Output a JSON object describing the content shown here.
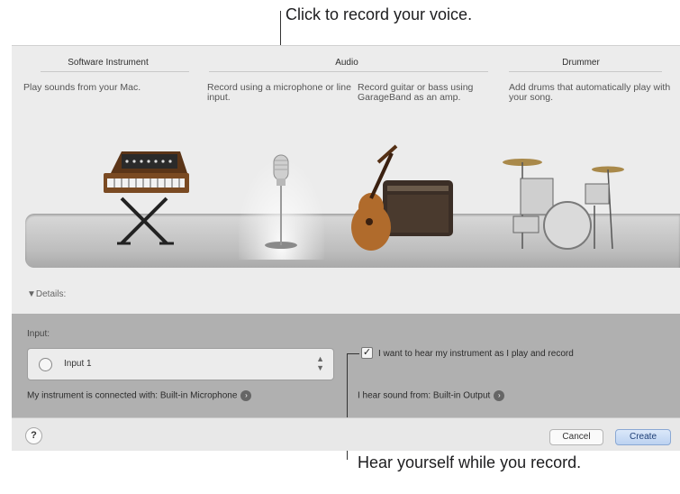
{
  "callouts": {
    "top": "Click to record your voice.",
    "bottom": "Hear yourself while you record."
  },
  "categories": [
    {
      "title": "Software Instrument",
      "description": "Play sounds from your Mac.",
      "icon": "keyboard-synth-icon"
    },
    {
      "title": "Audio",
      "description_mic": "Record using a microphone or line input.",
      "description_guitar": "Record guitar or bass using GarageBand as an amp.",
      "icon": "microphone-icon"
    },
    {
      "title": "Drummer",
      "description": "Add drums that automatically play with your song.",
      "icon": "drum-kit-icon"
    }
  ],
  "details": {
    "toggle_label": "▼Details:",
    "input_label": "Input:",
    "input_value": "Input 1",
    "connected_label": "My instrument is connected with: Built-in Microphone",
    "monitor_checkbox_label": "I want to hear my instrument as I play and record",
    "monitor_checked": true,
    "output_label": "I hear sound from: Built-in Output"
  },
  "footer": {
    "help_label": "?",
    "cancel_label": "Cancel",
    "create_label": "Create"
  },
  "colors": {
    "panel": "#b0b0b0",
    "dialog": "#ececec",
    "accent_button": "#bcd2f1"
  }
}
